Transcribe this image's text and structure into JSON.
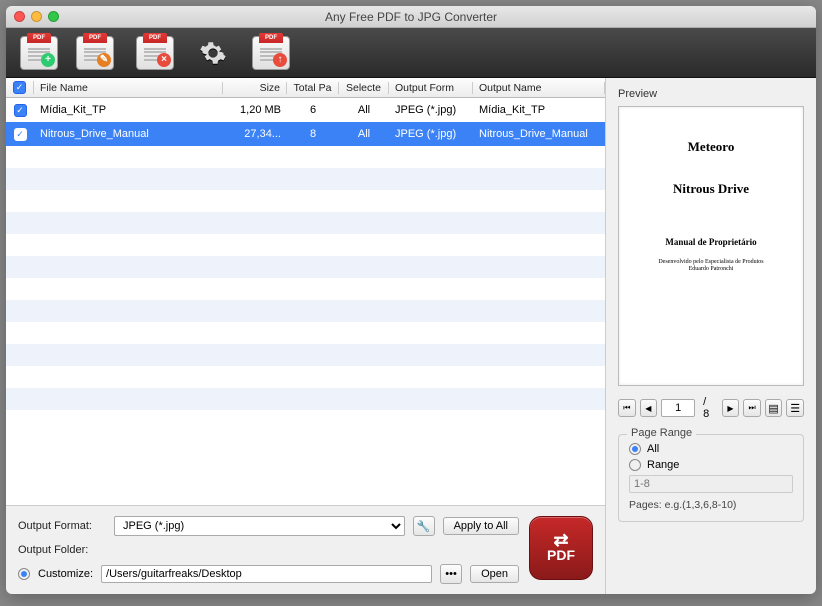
{
  "title": "Any Free PDF to JPG Converter",
  "toolbar": {
    "pdf_tab": "PDF"
  },
  "table": {
    "headers": {
      "file_name": "File Name",
      "size": "Size",
      "total": "Total Pa",
      "selected": "Selecte",
      "output_format": "Output Form",
      "output_name": "Output Name"
    },
    "rows": [
      {
        "checked": true,
        "name": "Mídia_Kit_TP",
        "size": "1,20 MB",
        "total": "6",
        "selected": "All",
        "format": "JPEG (*.jpg)",
        "outname": "Mídia_Kit_TP"
      },
      {
        "checked": true,
        "name": "Nitrous_Drive_Manual",
        "size": "27,34...",
        "total": "8",
        "selected": "All",
        "format": "JPEG (*.jpg)",
        "outname": "Nitrous_Drive_Manual"
      }
    ]
  },
  "bottom": {
    "output_format_label": "Output Format:",
    "output_format_value": "JPEG (*.jpg)",
    "apply_to_all": "Apply to All",
    "output_folder_label": "Output Folder:",
    "customize_label": "Customize:",
    "customize_path": "/Users/guitarfreaks/Desktop",
    "open": "Open",
    "browse": "•••",
    "big_pdf_label": "PDF"
  },
  "preview": {
    "label": "Preview",
    "t1": "Meteoro",
    "t2": "Nitrous Drive",
    "t3": "Manual de Proprietário",
    "t4a": "Desenvolvido pelo Especialista de Produtos",
    "t4b": "Eduardo Patronchi",
    "page_current": "1",
    "page_total": "/ 8"
  },
  "page_range": {
    "legend": "Page Range",
    "all": "All",
    "range": "Range",
    "range_placeholder": "1-8",
    "hint": "Pages: e.g.(1,3,6,8-10)"
  }
}
